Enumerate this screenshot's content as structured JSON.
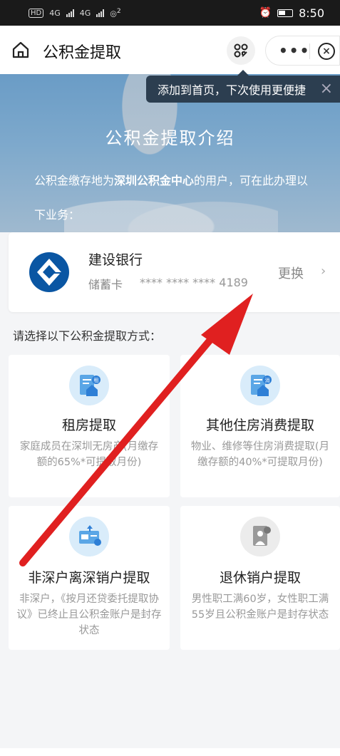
{
  "status_bar": {
    "hd": "HD",
    "network1": "4G",
    "network2": "4G",
    "wifi_sup": "2",
    "time": "8:50"
  },
  "nav": {
    "title": "公积金提取",
    "scan_label": "○○\n○↖"
  },
  "tooltip": {
    "text": "添加到首页，下次使用更便捷",
    "close": "×"
  },
  "hero": {
    "title": "公积金提取介绍",
    "desc_prefix": "公积金缴存地为",
    "desc_bold": "深圳公积金中心",
    "desc_suffix": "的用户，可在此办理以下业务："
  },
  "bank_card": {
    "bank_name": "建设银行",
    "card_type": "储蓄卡",
    "card_number": "**** **** **** 4189",
    "change_label": "更换",
    "chevron": "›"
  },
  "section_label": "请选择以下公积金提取方式：",
  "options": [
    {
      "title": "租房提取",
      "desc": "家庭成员在深圳无房产(月缴存额的65%*可提取月份)",
      "icon": "house-rent-icon"
    },
    {
      "title": "其他住房消费提取",
      "desc": "物业、维修等住房消费提取(月缴存额的40%*可提取月份)",
      "icon": "house-consume-icon"
    },
    {
      "title": "非深户离深销户提取",
      "desc": "非深户，《按月还贷委托提取协议》已终止且公积金账户是封存状态",
      "icon": "card-transfer-icon"
    },
    {
      "title": "退休销户提取",
      "desc": "男性职工满60岁，女性职工满55岁且公积金账户是封存状态",
      "icon": "retire-icon"
    }
  ],
  "colors": {
    "accent_blue": "#2e8ce6",
    "ccb_blue": "#0a56a3",
    "arrow_red": "#e02020",
    "tooltip_bg": "#2c3e50"
  }
}
